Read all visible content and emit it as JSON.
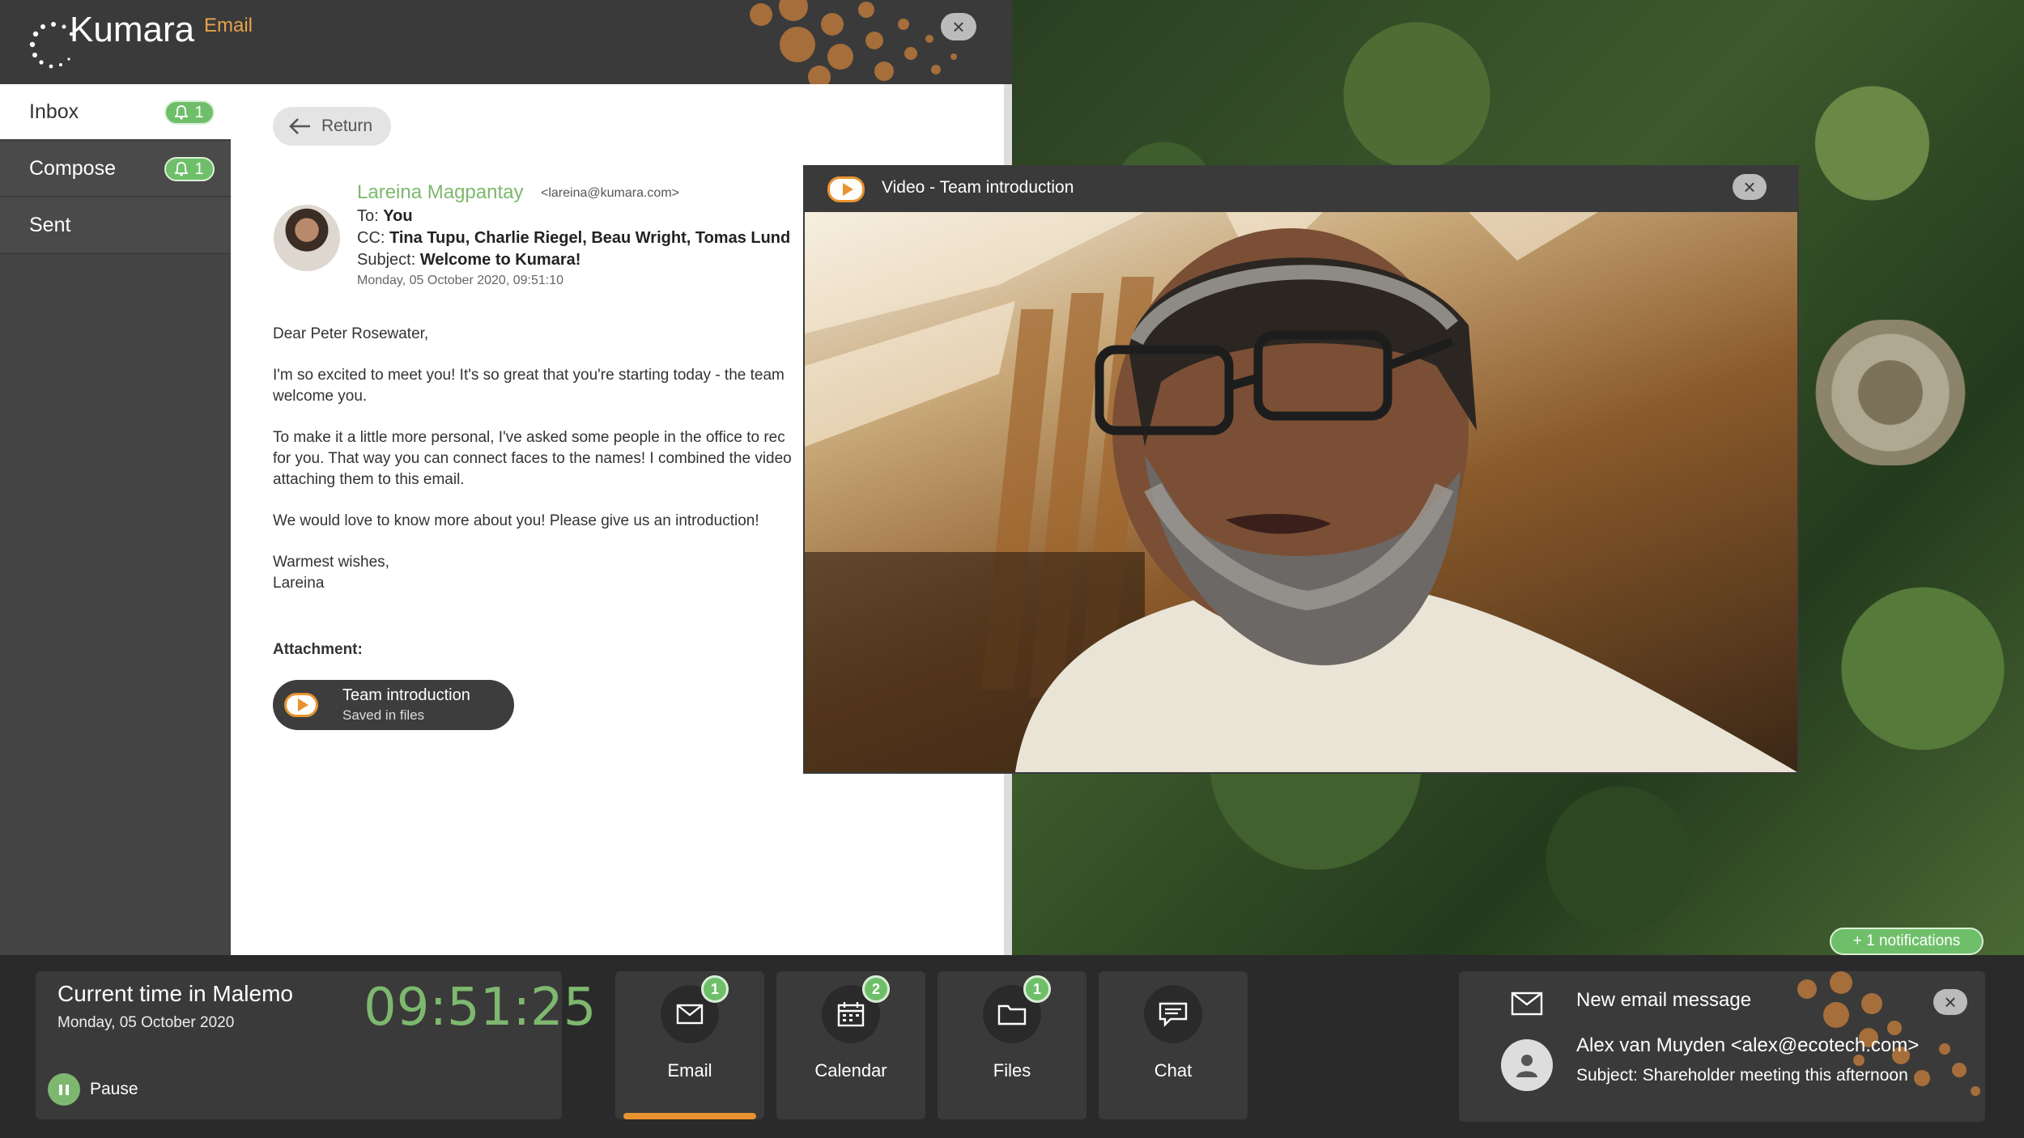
{
  "app": {
    "brand": "Kumara",
    "module": "Email"
  },
  "sidebar": {
    "items": [
      {
        "label": "Inbox",
        "badge": "1"
      },
      {
        "label": "Compose",
        "badge": "1"
      },
      {
        "label": "Sent"
      }
    ]
  },
  "email": {
    "return_label": "Return",
    "sender_name": "Lareina Magpantay",
    "sender_email": "<lareina@kumara.com>",
    "to_label": "To:",
    "to_value": "You",
    "cc_label": "CC:",
    "cc_value": "Tina Tupu, Charlie Riegel, Beau Wright, Tomas Lund",
    "subject_label": "Subject:",
    "subject_value": "Welcome to Kumara!",
    "date": "Monday, 05 October 2020, 09:51:10",
    "body": [
      "Dear Peter Rosewater,",
      "I'm so excited to meet you! It's so great that you're starting today - the team\nwelcome you.",
      "To make it a little more personal, I've asked some people in the office to rec\nfor you. That way you can connect faces to the names! I combined the video\nattaching them to this email.",
      "We would love to know more about you! Please give us an introduction!",
      "Warmest wishes,\nLareina"
    ],
    "attachment_label": "Attachment:",
    "attachment_name": "Team introduction",
    "attachment_status": "Saved in files"
  },
  "video_window": {
    "title": "Video - Team introduction"
  },
  "clock": {
    "title": "Current time in Malemo",
    "date": "Monday, 05 October 2020",
    "time": "09:51:25",
    "pause_label": "Pause"
  },
  "dock": [
    {
      "label": "Email",
      "badge": "1",
      "icon": "mail-icon",
      "active": true
    },
    {
      "label": "Calendar",
      "badge": "2",
      "icon": "calendar-icon"
    },
    {
      "label": "Files",
      "badge": "1",
      "icon": "folder-icon"
    },
    {
      "label": "Chat",
      "icon": "chat-icon"
    }
  ],
  "notifications": {
    "more": "+ 1 notifications",
    "title": "New email message",
    "from": "Alex van Muyden <alex@ecotech.com>",
    "subject": "Subject: Shareholder meeting this afternoon"
  },
  "colors": {
    "accent": "#e8932f",
    "green": "#7db86e",
    "dark": "#3a3a3a"
  }
}
